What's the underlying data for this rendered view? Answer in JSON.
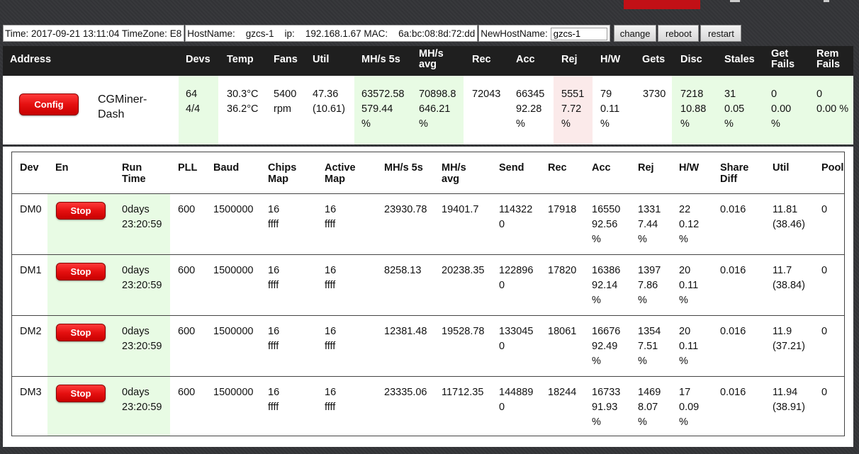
{
  "info": {
    "time_label": "Time:",
    "time": "2017-09-21 13:11:04",
    "tz_label": "TimeZone:",
    "tz": "E8",
    "host_label": "HostName:",
    "host": "gzcs-1",
    "ip_label": "ip:",
    "ip": "192.168.1.67",
    "mac_label": "MAC:",
    "mac": "6a:bc:08:8d:72:dd",
    "newhost_label": "NewHostName:",
    "newhost_value": "gzcs-1",
    "change": "change",
    "reboot": "reboot",
    "restart": "restart"
  },
  "summary": {
    "headers": {
      "address": "Address",
      "devs": "Devs",
      "temp": "Temp",
      "fans": "Fans",
      "util": "Util",
      "mh5s": "MH/s 5s",
      "mhavg": "MH/s\navg",
      "rec": "Rec",
      "acc": "Acc",
      "rej": "Rej",
      "hw": "H/W",
      "gets": "Gets",
      "disc": "Disc",
      "stales": "Stales",
      "getfails": "Get\nFails",
      "remfails": "Rem\nFails"
    },
    "config": "Config",
    "name": "CGMiner-\nDash",
    "devs": "64\n4/4",
    "temp": "30.3°C\n36.2°C",
    "fans": "5400\nrpm",
    "util": "47.36\n(10.61)",
    "mh5s": "63572.58\n579.44\n%",
    "mhavg": "70898.8\n646.21\n%",
    "rec": "72043",
    "acc": "66345\n92.28\n%",
    "rej": "5551\n7.72\n%",
    "hw": "79\n0.11\n%",
    "gets": "3730",
    "disc": "7218\n10.88\n%",
    "stales": "31\n0.05\n%",
    "getfails": "0\n0.00\n%",
    "remfails": "0\n0.00 %"
  },
  "devices": {
    "headers": {
      "dev": "Dev",
      "en": "En",
      "runtime": "Run\nTime",
      "pll": "PLL",
      "baud": "Baud",
      "chips": "Chips\nMap",
      "active": "Active\nMap",
      "mh5s": "MH/s 5s",
      "mhavg": "MH/s\navg",
      "send": "Send",
      "rec": "Rec",
      "acc": "Acc",
      "rej": "Rej",
      "hw": "H/W",
      "share": "Share\nDiff",
      "util": "Util",
      "pool": "Pool"
    },
    "rows": [
      {
        "dev": "DM0",
        "stop": "Stop",
        "runtime": "0days\n23:20:59",
        "pll": "600",
        "baud": "1500000",
        "chips": "16\nffff",
        "active": "16\nffff",
        "mh5s": "23930.78",
        "mhavg": "19401.7",
        "send": "114322\n0",
        "rec": "17918",
        "acc": "16550\n92.56\n%",
        "rej": "1331\n7.44\n%",
        "hw": "22\n0.12\n%",
        "share": "0.016",
        "util": "11.81\n(38.46)",
        "pool": "0"
      },
      {
        "dev": "DM1",
        "stop": "Stop",
        "runtime": "0days\n23:20:59",
        "pll": "600",
        "baud": "1500000",
        "chips": "16\nffff",
        "active": "16\nffff",
        "mh5s": "8258.13",
        "mhavg": "20238.35",
        "send": "122896\n0",
        "rec": "17820",
        "acc": "16386\n92.14\n%",
        "rej": "1397\n7.86\n%",
        "hw": "20\n0.11\n%",
        "share": "0.016",
        "util": "11.7\n(38.84)",
        "pool": "0"
      },
      {
        "dev": "DM2",
        "stop": "Stop",
        "runtime": "0days\n23:20:59",
        "pll": "600",
        "baud": "1500000",
        "chips": "16\nffff",
        "active": "16\nffff",
        "mh5s": "12381.48",
        "mhavg": "19528.78",
        "send": "133045\n0",
        "rec": "18061",
        "acc": "16676\n92.49\n%",
        "rej": "1354\n7.51\n%",
        "hw": "20\n0.11\n%",
        "share": "0.016",
        "util": "11.9\n(37.21)",
        "pool": "0"
      },
      {
        "dev": "DM3",
        "stop": "Stop",
        "runtime": "0days\n23:20:59",
        "pll": "600",
        "baud": "1500000",
        "chips": "16\nffff",
        "active": "16\nffff",
        "mh5s": "23335.06",
        "mhavg": "11712.35",
        "send": "144889\n0",
        "rec": "18244",
        "acc": "16733\n91.93\n%",
        "rej": "1469\n8.07\n%",
        "hw": "17\n0.09\n%",
        "share": "0.016",
        "util": "11.94\n(38.91)",
        "pool": "0"
      }
    ]
  }
}
